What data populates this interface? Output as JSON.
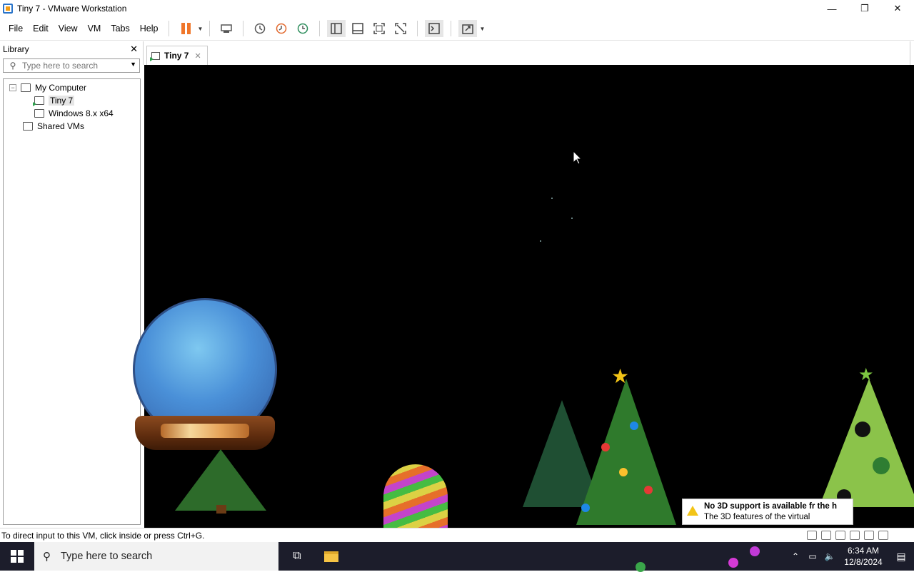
{
  "window": {
    "title": "Tiny 7 - VMware Workstation",
    "controls": {
      "minimize": "—",
      "restore": "❐",
      "close": "✕"
    }
  },
  "menu": [
    "File",
    "Edit",
    "View",
    "VM",
    "Tabs",
    "Help"
  ],
  "toolbar_icons": [
    "pause-icon",
    "send-ctrl-alt-del-icon",
    "snapshot-icon",
    "revert-snapshot-icon",
    "snapshot-manager-icon",
    "library-view-icon",
    "thumbnail-bar-icon",
    "fullscreen-icon",
    "unity-icon",
    "console-view-icon",
    "stretch-view-icon"
  ],
  "library": {
    "title": "Library",
    "close": "✕",
    "search_placeholder": "Type here to search",
    "tree": {
      "root": "My Computer",
      "root_expander": "−",
      "children": [
        "Tiny 7",
        "Windows 8.x x64"
      ],
      "shared": "Shared VMs"
    }
  },
  "tab": {
    "label": "Tiny 7",
    "close": "✕"
  },
  "toast": {
    "title": "No 3D support is available fr",
    "title_tail": "the h",
    "body": "The 3D features of the virtual"
  },
  "status": {
    "message": "To direct input to this VM, click inside or press Ctrl+G."
  },
  "taskbar": {
    "search_placeholder": "Type here to search",
    "time": "6:34 AM",
    "date": "12/8/2024"
  }
}
